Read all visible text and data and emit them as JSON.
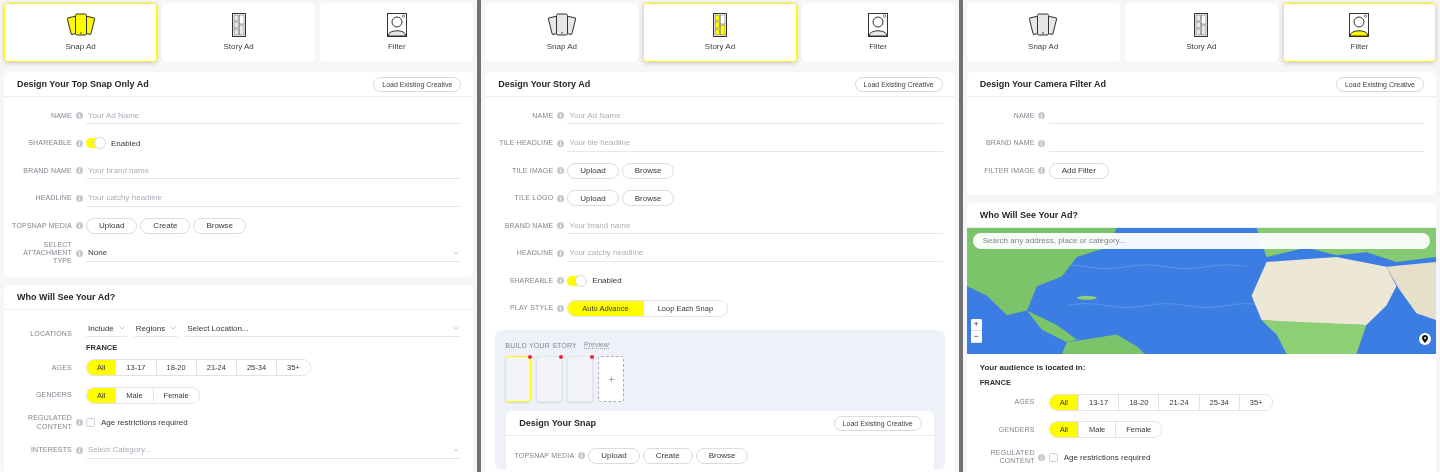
{
  "panels": [
    {
      "ad_types": [
        {
          "label": "Snap Ad",
          "kind": "snap",
          "selected": true
        },
        {
          "label": "Story Ad",
          "kind": "story",
          "selected": false
        },
        {
          "label": "Filter",
          "kind": "filter",
          "selected": false
        }
      ],
      "sections": [
        {
          "kind": "form",
          "title": "Design Your Top Snap Only Ad",
          "action": "Load Existing Creative",
          "rows": [
            {
              "kind": "text",
              "label": "NAME",
              "info": true,
              "placeholder": "Your Ad Name"
            },
            {
              "kind": "toggle",
              "label": "SHAREABLE",
              "info": true,
              "on": true,
              "text": "Enabled"
            },
            {
              "kind": "text",
              "label": "BRAND NAME",
              "info": true,
              "placeholder": "Your brand name"
            },
            {
              "kind": "text",
              "label": "HEADLINE",
              "info": true,
              "placeholder": "Your catchy headline"
            },
            {
              "kind": "buttons",
              "label": "TOPSNAP MEDIA",
              "info": true,
              "buttons": [
                "Upload",
                "Create",
                "Browse"
              ]
            },
            {
              "kind": "select",
              "label": "SELECT ATTACHMENT TYPE",
              "info": true,
              "value": "None"
            }
          ]
        },
        {
          "kind": "form",
          "title": "Who Will See Your Ad?",
          "rows": [
            {
              "kind": "locations",
              "label": "LOCATIONS",
              "info": false,
              "selects": [
                "Include",
                "Regions",
                "Select Location..."
              ],
              "tags": [
                "FRANCE"
              ]
            },
            {
              "kind": "segmented",
              "label": "AGES",
              "info": false,
              "options": [
                {
                  "label": "All",
                  "selected": true
                },
                {
                  "label": "13-17",
                  "selected": false
                },
                {
                  "label": "18-20",
                  "selected": false
                },
                {
                  "label": "21-24",
                  "selected": false
                },
                {
                  "label": "25-34",
                  "selected": false
                },
                {
                  "label": "35+",
                  "selected": false
                }
              ]
            },
            {
              "kind": "segmented",
              "label": "GENDERS",
              "info": false,
              "options": [
                {
                  "label": "All",
                  "selected": true
                },
                {
                  "label": "Male",
                  "selected": false
                },
                {
                  "label": "Female",
                  "selected": false
                }
              ]
            },
            {
              "kind": "checkbox",
              "label": "REGULATED CONTENT",
              "info": true,
              "checked": false,
              "text": "Age restrictions required"
            },
            {
              "kind": "select",
              "label": "INTERESTS",
              "info": true,
              "placeholder": "Select Category..."
            }
          ]
        }
      ]
    },
    {
      "ad_types": [
        {
          "label": "Snap Ad",
          "kind": "snap",
          "selected": false
        },
        {
          "label": "Story Ad",
          "kind": "story",
          "selected": true
        },
        {
          "label": "Filter",
          "kind": "filter",
          "selected": false
        }
      ],
      "sections": [
        {
          "kind": "form",
          "title": "Design Your Story Ad",
          "action": "Load Existing Creative",
          "rows": [
            {
              "kind": "text",
              "label": "NAME",
              "info": true,
              "placeholder": "Your Ad Name"
            },
            {
              "kind": "text",
              "label": "TILE HEADLINE",
              "info": true,
              "placeholder": "Your tile headline"
            },
            {
              "kind": "buttons",
              "label": "TILE IMAGE",
              "info": true,
              "buttons": [
                "Upload",
                "Browse"
              ]
            },
            {
              "kind": "buttons",
              "label": "TILE LOGO",
              "info": true,
              "buttons": [
                "Upload",
                "Browse"
              ]
            },
            {
              "kind": "text",
              "label": "BRAND NAME",
              "info": true,
              "placeholder": "Your brand name"
            },
            {
              "kind": "text",
              "label": "HEADLINE",
              "info": true,
              "placeholder": "Your catchy headline"
            },
            {
              "kind": "toggle",
              "label": "SHAREABLE",
              "info": true,
              "on": true,
              "text": "Enabled"
            },
            {
              "kind": "segmented",
              "label": "PLAY STYLE",
              "info": true,
              "options": [
                {
                  "label": "Auto Advance",
                  "selected": true
                },
                {
                  "label": "Loop Each Snap",
                  "selected": false
                }
              ]
            },
            {
              "kind": "story",
              "title": "BUILD YOUR STORY",
              "link": "Preview",
              "tiles": [
                {
                  "selected": true,
                  "alert": true
                },
                {
                  "selected": false,
                  "alert": true
                },
                {
                  "selected": false,
                  "alert": true
                }
              ],
              "add": "+",
              "snap": {
                "title": "Design Your Snap",
                "action": "Load Existing Creative",
                "rows": [
                  {
                    "kind": "buttons",
                    "label": "TOPSNAP MEDIA",
                    "info": true,
                    "buttons": [
                      "Upload",
                      "Create",
                      "Browse"
                    ]
                  }
                ]
              }
            }
          ]
        }
      ]
    },
    {
      "ad_types": [
        {
          "label": "Snap Ad",
          "kind": "snap",
          "selected": false
        },
        {
          "label": "Story Ad",
          "kind": "story",
          "selected": false
        },
        {
          "label": "Filter",
          "kind": "filter",
          "selected": true
        }
      ],
      "sections": [
        {
          "kind": "form",
          "title": "Design Your Camera Filter Ad",
          "action": "Load Existing Creative",
          "rows": [
            {
              "kind": "text",
              "label": "NAME",
              "info": true
            },
            {
              "kind": "text",
              "label": "BRAND NAME",
              "info": true
            },
            {
              "kind": "buttons",
              "label": "FILTER IMAGE",
              "info": true,
              "buttons": [
                "Add Filter"
              ]
            }
          ]
        },
        {
          "kind": "audience_map",
          "title": "Who Will See Your Ad?",
          "map": {
            "search_placeholder": "Search any address, place or category...",
            "zoom_in": "+",
            "zoom_out": "−"
          },
          "located_label": "Your audience is located in:",
          "tags": [
            "FRANCE"
          ],
          "rows": [
            {
              "kind": "segmented",
              "label": "AGES",
              "info": false,
              "options": [
                {
                  "label": "All",
                  "selected": true
                },
                {
                  "label": "13-17",
                  "selected": false
                },
                {
                  "label": "18-20",
                  "selected": false
                },
                {
                  "label": "21-24",
                  "selected": false
                },
                {
                  "label": "25-34",
                  "selected": false
                },
                {
                  "label": "35+",
                  "selected": false
                }
              ]
            },
            {
              "kind": "segmented",
              "label": "GENDERS",
              "info": false,
              "options": [
                {
                  "label": "All",
                  "selected": true
                },
                {
                  "label": "Male",
                  "selected": false
                },
                {
                  "label": "Female",
                  "selected": false
                }
              ]
            },
            {
              "kind": "checkbox",
              "label": "REGULATED CONTENT",
              "info": true,
              "checked": false,
              "text": "Age restrictions required"
            }
          ]
        }
      ]
    }
  ]
}
